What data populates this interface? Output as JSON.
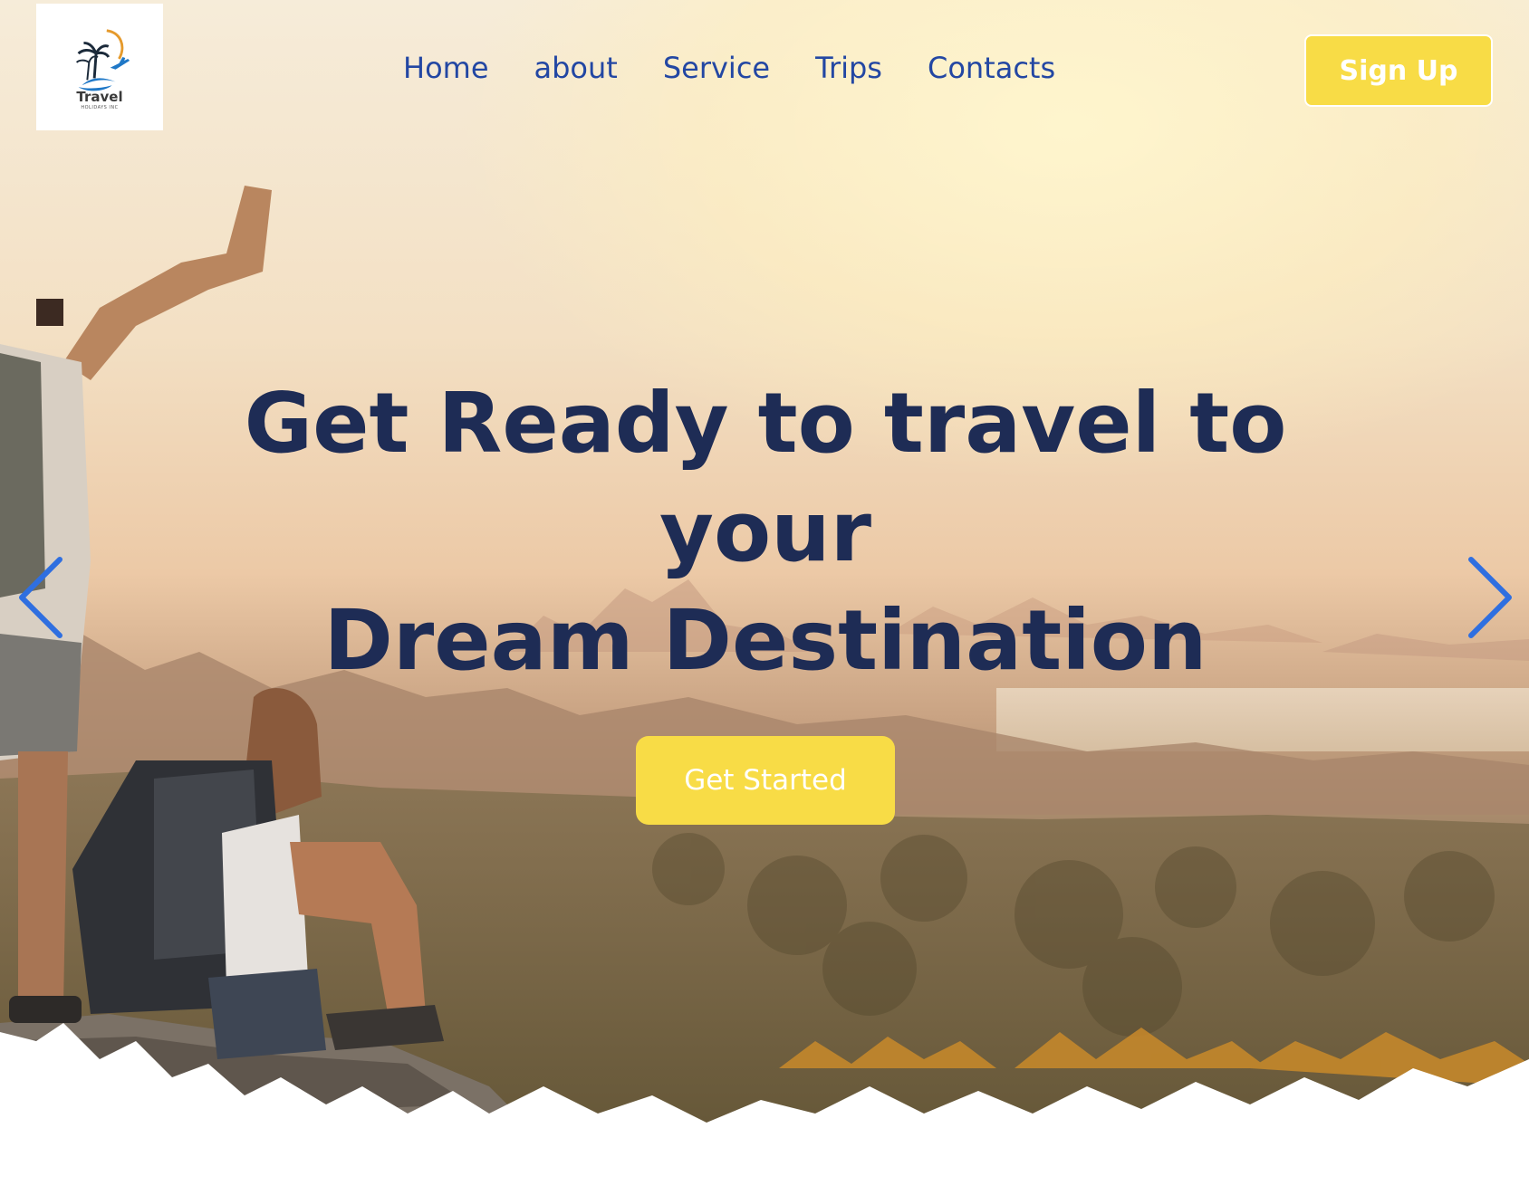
{
  "logo": {
    "word": "Travel",
    "tagline": "HOLIDAYS INC",
    "icon": "palm-tree-plane-icon"
  },
  "nav": {
    "items": [
      {
        "label": "Home"
      },
      {
        "label": "about"
      },
      {
        "label": "Service"
      },
      {
        "label": "Trips"
      },
      {
        "label": "Contacts"
      }
    ],
    "signup_label": "Sign Up"
  },
  "hero": {
    "headline_line1": "Get Ready to travel to",
    "headline_line2": "your",
    "headline_line3": "Dream Destination",
    "cta_label": "Get Started",
    "prev_icon": "chevron-left-icon",
    "next_icon": "chevron-right-icon"
  },
  "colors": {
    "accent_yellow": "#f8dc46",
    "nav_blue": "#2347a3",
    "headline_navy": "#1e2c55",
    "arrow_blue": "#2f6fe0"
  }
}
